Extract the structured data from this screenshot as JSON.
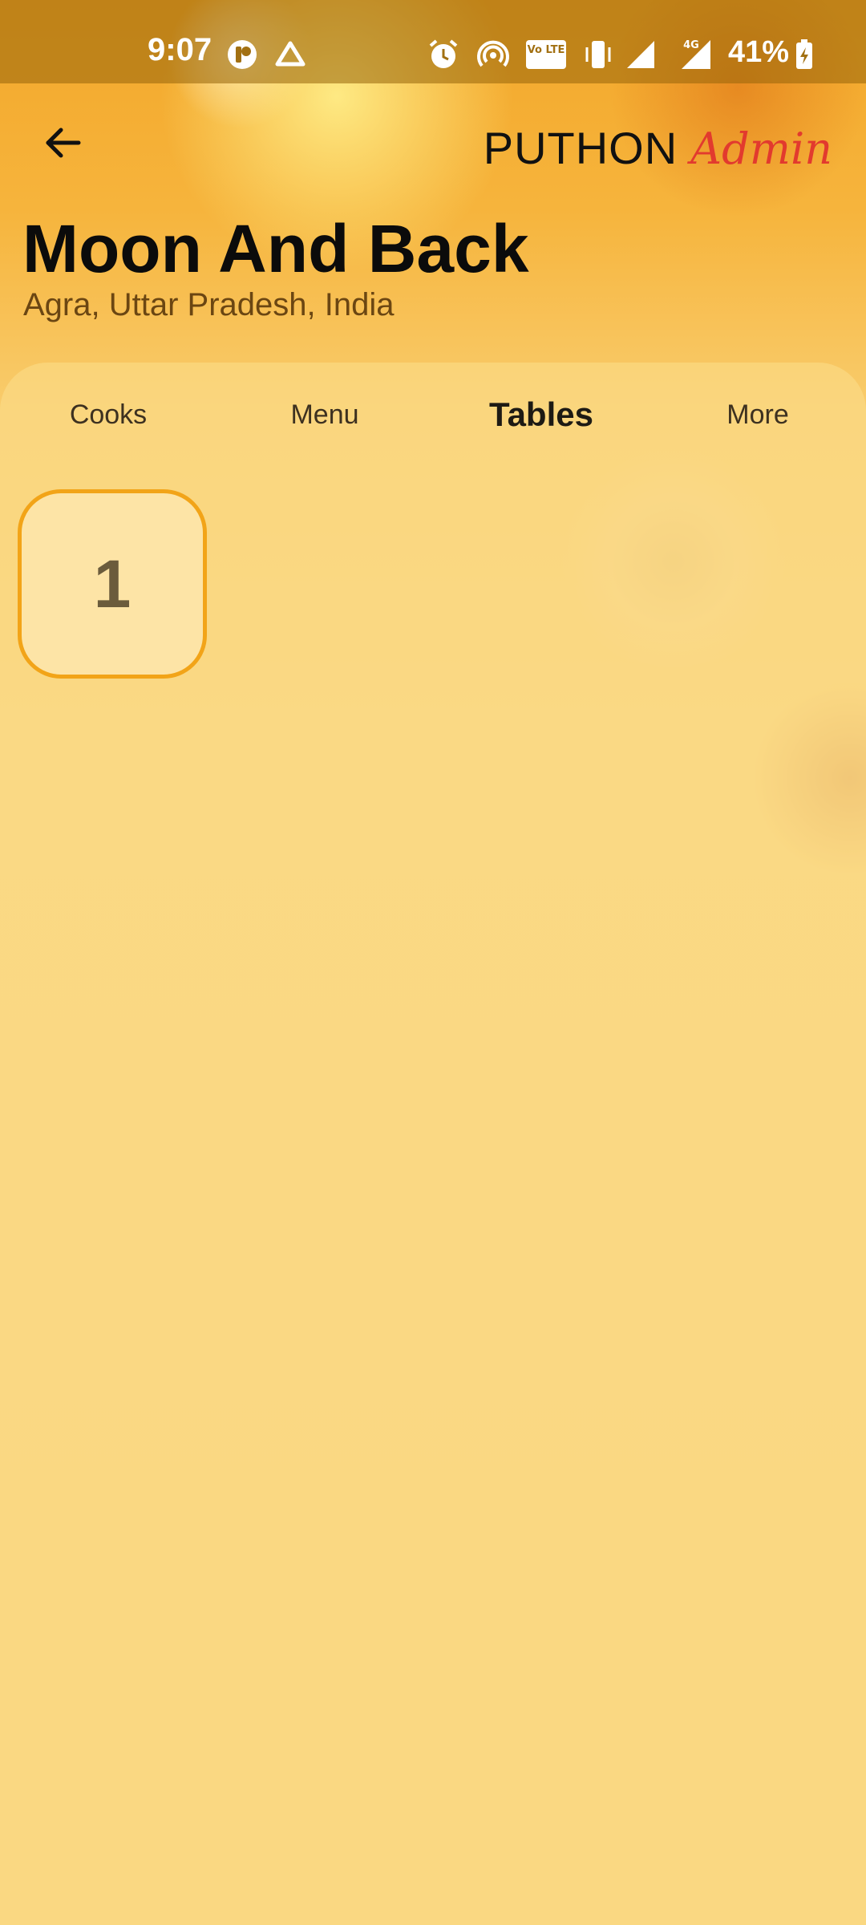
{
  "status_bar": {
    "time": "9:07",
    "battery": "41%",
    "icons": [
      "app-notification-icon",
      "drive-icon",
      "alarm-icon",
      "hotspot-icon",
      "volte-icon",
      "vibrate-icon",
      "signal-icon",
      "signal-4g-icon",
      "battery-charging-icon"
    ],
    "volte_label": "Vo LTE",
    "network_label": "4G"
  },
  "header": {
    "back_icon": "arrow-left-icon",
    "brand_main": "PUTHON",
    "brand_accent": "Admin",
    "brand_accent_color": "#e23a2e"
  },
  "restaurant": {
    "name": "Moon And Back",
    "location": "Agra, Uttar Pradesh, India"
  },
  "tabs": [
    {
      "label": "Cooks",
      "active": false
    },
    {
      "label": "Menu",
      "active": false
    },
    {
      "label": "Tables",
      "active": true
    },
    {
      "label": "More",
      "active": false
    }
  ],
  "tables": [
    {
      "number": "1"
    }
  ],
  "colors": {
    "accent": "#f2a418",
    "card_fill": "#fde4a6",
    "background": "#f9d27a"
  }
}
